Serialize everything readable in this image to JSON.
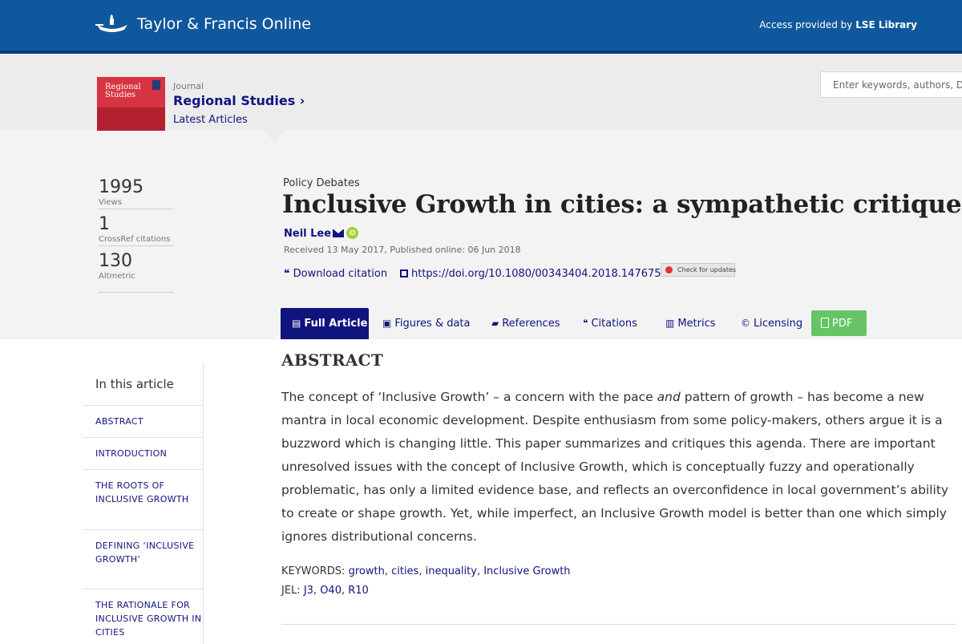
{
  "header": {
    "logo_text": "Taylor & Francis Online",
    "access_prefix": "Access provided by",
    "access_library": "LSE Library",
    "colors": {
      "topbar": "#10589d",
      "accent": "#10147e",
      "pdf": "#66c466"
    }
  },
  "journal": {
    "cover_title": "Regional Studies",
    "label": "Journal",
    "name": "Regional Studies",
    "chevron": "›",
    "latest": "Latest Articles"
  },
  "search": {
    "placeholder": "Enter keywords, authors, DOI, ORCID, etc"
  },
  "stats": [
    {
      "value": "1995",
      "label": "Views"
    },
    {
      "value": "1",
      "label": "CrossRef citations"
    },
    {
      "value": "130",
      "label": "Altmetric"
    }
  ],
  "article": {
    "section": "Policy Debates",
    "title": "Inclusive Growth in cities: a sympathetic critique",
    "author": "Neil Lee",
    "dates": "Received 13 May 2017, Published online: 06 Jun 2018",
    "download_citation": "Download citation",
    "doi": "https://doi.org/10.1080/00343404.2018.1476753",
    "check_updates": "Check for updates"
  },
  "tabs": [
    {
      "label": "Full Article",
      "icon": "document-icon",
      "active": true
    },
    {
      "label": "Figures & data",
      "icon": "image-icon"
    },
    {
      "label": "References",
      "icon": "book-icon"
    },
    {
      "label": "Citations",
      "icon": "quote-icon"
    },
    {
      "label": "Metrics",
      "icon": "bar-chart-icon"
    },
    {
      "label": "Licensing",
      "icon": "copyright-icon"
    },
    {
      "label": "PDF",
      "icon": "pdf-icon"
    }
  ],
  "abstract": {
    "heading": "ABSTRACT",
    "text_1": "The concept of ‘Inclusive Growth’ – a concern with the pace ",
    "text_em": "and",
    "text_2": " pattern of growth – has become a new mantra in local economic development. Despite enthusiasm from some policy-makers, others argue it is a buzzword which is changing little. This paper summarizes and critiques this agenda. There are important unresolved issues with the concept of Inclusive Growth, which is conceptually fuzzy and operationally problematic, has only a limited evidence base, and reflects an overconfidence in local government’s ability to create or shape growth. Yet, while imperfect, an Inclusive Growth model is better than one which simply ignores distributional concerns.",
    "keywords_label": "KEYWORDS:",
    "keywords": [
      "growth",
      "cities",
      "inequality",
      "Inclusive Growth"
    ],
    "jel_label": "JEL:",
    "jel": [
      "J3",
      "O40",
      "R10"
    ]
  },
  "toc": {
    "heading": "In this article",
    "items": [
      "ABSTRACT",
      "INTRODUCTION",
      "THE ROOTS OF INCLUSIVE GROWTH",
      "DEFINING ‘INCLUSIVE GROWTH’",
      "THE RATIONALE FOR INCLUSIVE GROWTH IN CITIES"
    ]
  }
}
